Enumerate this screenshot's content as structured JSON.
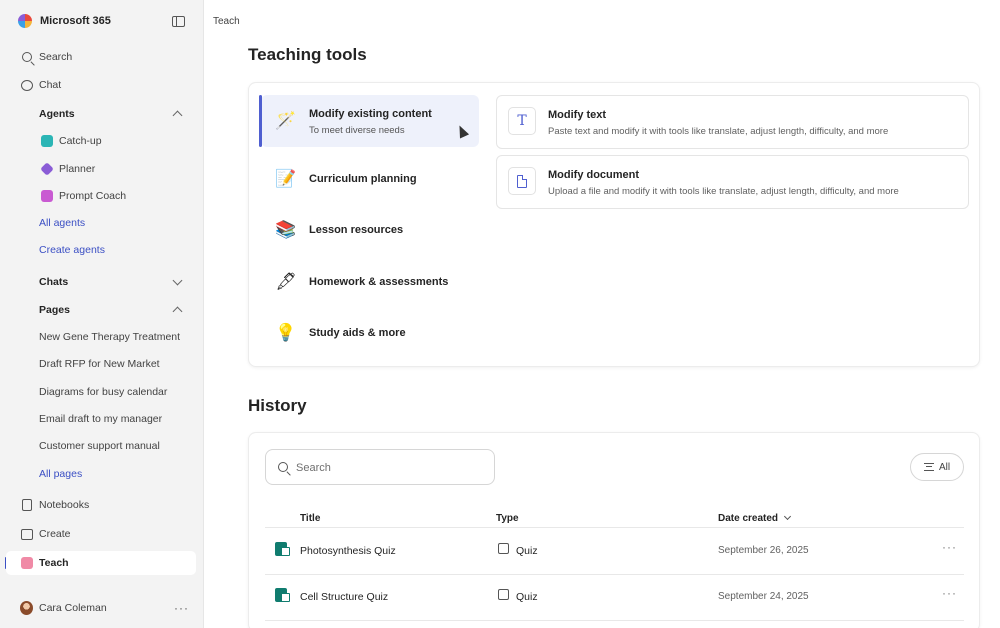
{
  "sidebar": {
    "brand": "Microsoft 365",
    "search": "Search",
    "chat": "Chat",
    "agents_header": "Agents",
    "agents": [
      {
        "label": "Catch-up",
        "color": "#2bb5b5"
      },
      {
        "label": "Planner",
        "color": "#8a5cd6"
      },
      {
        "label": "Prompt Coach",
        "color": "#c95ad2"
      }
    ],
    "all_agents": "All agents",
    "create_agents": "Create agents",
    "chats_header": "Chats",
    "pages_header": "Pages",
    "pages": [
      "New Gene Therapy Treatment",
      "Draft RFP for New Market",
      "Diagrams for busy calendar",
      "Email draft to my manager",
      "Customer support manual"
    ],
    "all_pages": "All pages",
    "notebooks": "Notebooks",
    "create": "Create",
    "teach": "Teach",
    "user": "Cara Coleman"
  },
  "breadcrumb": "Teach",
  "teaching_tools": {
    "title": "Teaching tools",
    "items": [
      {
        "label": "Modify existing content",
        "sub": "To meet diverse needs",
        "icon": "magic-wand-icon",
        "glyph": "🪄"
      },
      {
        "label": "Curriculum planning",
        "icon": "notepad-icon",
        "glyph": "📝"
      },
      {
        "label": "Lesson resources",
        "icon": "books-icon",
        "glyph": "📚"
      },
      {
        "label": "Homework & assessments",
        "icon": "pen-icon",
        "glyph": "🖋"
      },
      {
        "label": "Study aids & more",
        "icon": "lightbulb-icon",
        "glyph": "💡"
      }
    ],
    "options": [
      {
        "title": "Modify text",
        "desc": "Paste text and modify it with tools like translate, adjust length, difficulty, and more",
        "glyph": "T"
      },
      {
        "title": "Modify document",
        "desc": "Upload a file and modify it with tools like translate, adjust length, difficulty, and more"
      }
    ]
  },
  "history": {
    "title": "History",
    "search_placeholder": "Search",
    "filter_label": "All",
    "columns": {
      "title": "Title",
      "type": "Type",
      "date": "Date created"
    },
    "rows": [
      {
        "title": "Photosynthesis Quiz",
        "type": "Quiz",
        "date": "September 26, 2025"
      },
      {
        "title": "Cell Structure Quiz",
        "type": "Quiz",
        "date": "September 24, 2025"
      }
    ]
  }
}
